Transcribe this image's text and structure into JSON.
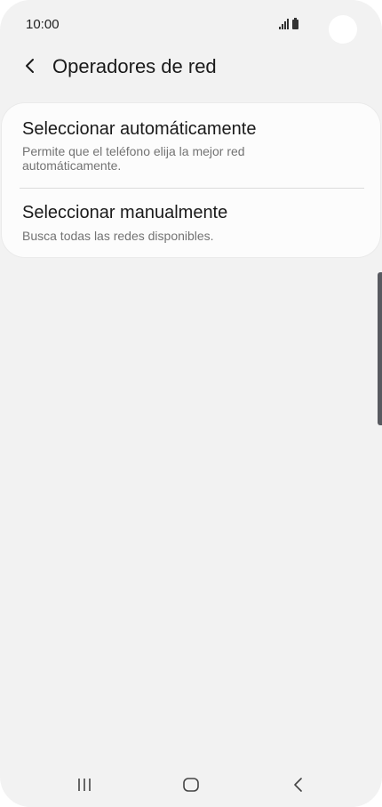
{
  "status_bar": {
    "time": "10:00"
  },
  "header": {
    "title": "Operadores de red",
    "back_icon": "chevron-left-icon"
  },
  "options": [
    {
      "title": "Seleccionar automáticamente",
      "description": "Permite que el teléfono elija la mejor red automáticamente."
    },
    {
      "title": "Seleccionar manualmente",
      "description": "Busca todas las redes disponibles."
    }
  ],
  "nav_bar": {
    "recent_icon": "recent-apps-icon",
    "home_icon": "home-icon",
    "back_icon": "back-icon"
  },
  "colors": {
    "background": "#f2f2f2",
    "card": "#fcfcfc",
    "primary_text": "#1a1a1a",
    "secondary_text": "#737373",
    "scroll_indicator": "#585a60"
  }
}
